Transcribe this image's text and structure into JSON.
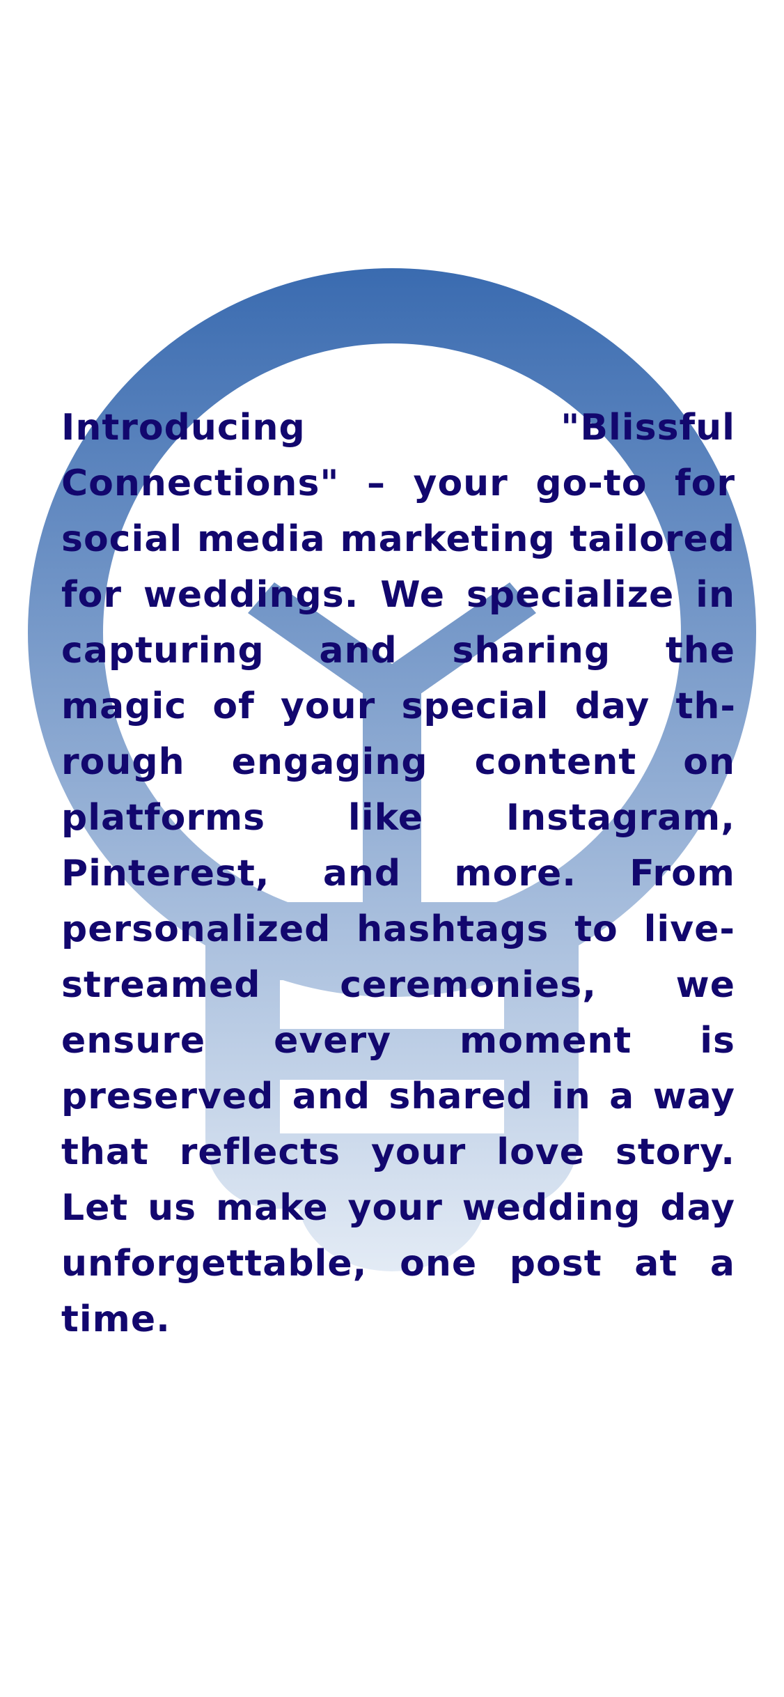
{
  "colors": {
    "background": "#ffffff",
    "text": "#12076e",
    "icon_top": "#3a6bb0",
    "icon_bottom": "#e3ebf5"
  },
  "icon": {
    "name": "lightbulb-icon"
  },
  "promo": {
    "text": "Introducing \"Blissful Connections\" – your go-to for social media mar­keting tailored for weddings. We specialize in capturing and sharing the magic of your special day th­rough engaging content on plat­forms like Instagram, Pinterest, and more. From personalized hash­tags to live-streamed ceremonies, we ensure every moment is preser­ved and shared in a way that re­flects your love story. Let us make your wedding day unforgettable, one post at a time."
  }
}
